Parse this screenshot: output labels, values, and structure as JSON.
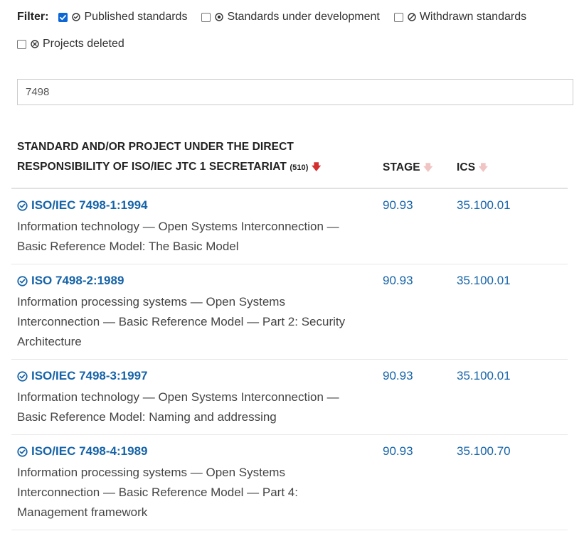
{
  "filter": {
    "label": "Filter:",
    "options": [
      {
        "label": "Published standards",
        "checked": true,
        "icon": "published-check-icon"
      },
      {
        "label": "Standards under development",
        "checked": false,
        "icon": "under-development-icon"
      },
      {
        "label": "Withdrawn standards",
        "checked": false,
        "icon": "withdrawn-icon"
      },
      {
        "label": "Projects deleted",
        "checked": false,
        "icon": "deleted-icon"
      }
    ]
  },
  "search": {
    "value": "7498",
    "placeholder": ""
  },
  "table": {
    "header": {
      "standard_line1": "Standard and/or project under the direct",
      "standard_line2": "responsibility of ISO/IEC JTC 1 Secretariat",
      "count": "(510)",
      "stage": "Stage",
      "ics": "ICS",
      "sort_active_icon": "arrow-down-icon",
      "sort_inactive_icon": "arrow-down-icon"
    },
    "rows": [
      {
        "ref": "ISO/IEC 7498-1:1994",
        "title": "Information technology — Open Systems Interconnection — Basic Reference Model: The Basic Model",
        "stage": "90.93",
        "ics": "35.100.01"
      },
      {
        "ref": "ISO 7498-2:1989",
        "title": "Information processing systems — Open Systems Interconnection — Basic Reference Model — Part 2: Security Architecture",
        "stage": "90.93",
        "ics": "35.100.01"
      },
      {
        "ref": "ISO/IEC 7498-3:1997",
        "title": "Information technology — Open Systems Interconnection — Basic Reference Model: Naming and addressing",
        "stage": "90.93",
        "ics": "35.100.01"
      },
      {
        "ref": "ISO/IEC 7498-4:1989",
        "title": "Information processing systems — Open Systems Interconnection — Basic Reference Model — Part 4: Management framework",
        "stage": "90.93",
        "ics": "35.100.70"
      }
    ]
  },
  "colors": {
    "link": "#1563a8",
    "checkbox": "#0b67d6",
    "sort_active": "#d32f2f",
    "sort_inactive": "#f1c4c4"
  }
}
